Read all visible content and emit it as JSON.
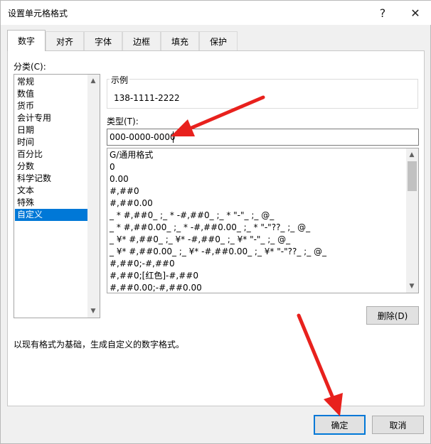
{
  "window": {
    "title": "设置单元格格式",
    "help": "?",
    "close": "✕"
  },
  "tabs": [
    "数字",
    "对齐",
    "字体",
    "边框",
    "填充",
    "保护"
  ],
  "category": {
    "label": "分类(C):",
    "items": [
      "常规",
      "数值",
      "货币",
      "会计专用",
      "日期",
      "时间",
      "百分比",
      "分数",
      "科学记数",
      "文本",
      "特殊",
      "自定义"
    ],
    "selected_index": 11
  },
  "sample": {
    "label": "示例",
    "value": "138-1111-2222"
  },
  "type": {
    "label": "类型(T):",
    "value": "000-0000-0000"
  },
  "formats": [
    "G/通用格式",
    "0",
    "0.00",
    "#,##0",
    "#,##0.00",
    "_ * #,##0_ ;_ * -#,##0_ ;_ * \"-\"_ ;_ @_",
    "_ * #,##0.00_ ;_ * -#,##0.00_ ;_ * \"-\"??_ ;_ @_",
    "_ ¥* #,##0_ ;_ ¥* -#,##0_ ;_ ¥* \"-\"_ ;_ @_",
    "_ ¥* #,##0.00_ ;_ ¥* -#,##0.00_ ;_ ¥* \"-\"??_ ;_ @_",
    "#,##0;-#,##0",
    "#,##0;[红色]-#,##0",
    "#,##0.00;-#,##0.00"
  ],
  "buttons": {
    "delete": "删除(D)",
    "ok": "确定",
    "cancel": "取消"
  },
  "description": "以现有格式为基础，生成自定义的数字格式。",
  "colors": {
    "accent": "#0078d7",
    "annotation": "#e8211d"
  }
}
